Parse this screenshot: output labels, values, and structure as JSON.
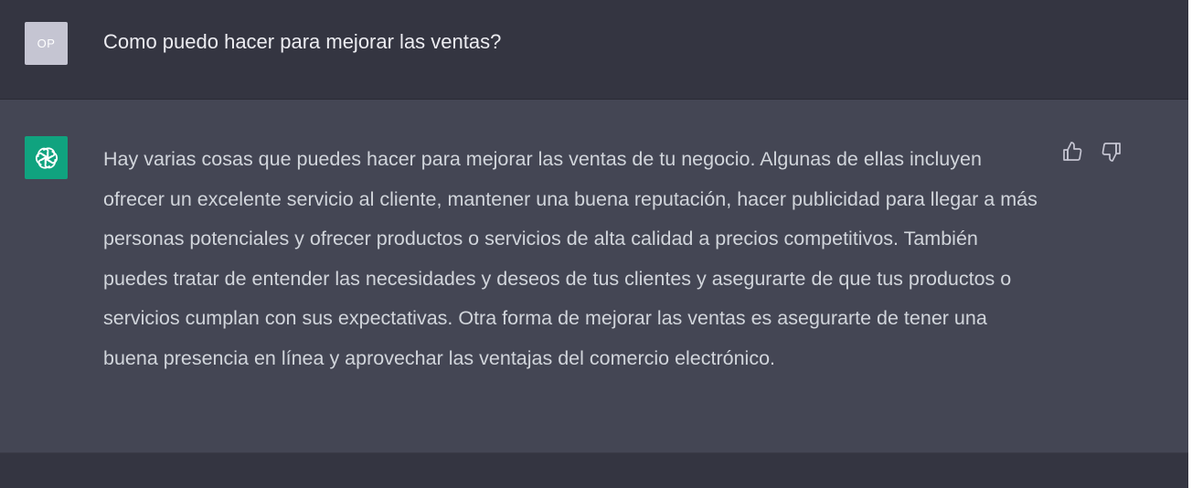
{
  "user_message": {
    "avatar_initials": "OP",
    "text": "Como puedo hacer para mejorar las ventas?"
  },
  "assistant_message": {
    "avatar_icon": "openai-logo-icon",
    "text": "Hay varias cosas que puedes hacer para mejorar las ventas de tu negocio. Algunas de ellas incluyen ofrecer un excelente servicio al cliente, mantener una buena reputación, hacer publicidad para llegar a más personas potenciales y ofrecer productos o servicios de alta calidad a precios competitivos. También puedes tratar de entender las necesidades y deseos de tus clientes y asegurarte de que tus productos o servicios cumplan con sus expectativas. Otra forma de mejorar las ventas es asegurarte de tener una buena presencia en línea y aprovechar las ventajas del comercio electrónico.",
    "feedback_icons": [
      "thumbs-up-icon",
      "thumbs-down-icon"
    ]
  },
  "colors": {
    "user_background": "#343541",
    "assistant_background": "#444654",
    "brand_green": "#10a37f",
    "user_avatar": "#c5c5d2",
    "text": "#d1d5db"
  }
}
